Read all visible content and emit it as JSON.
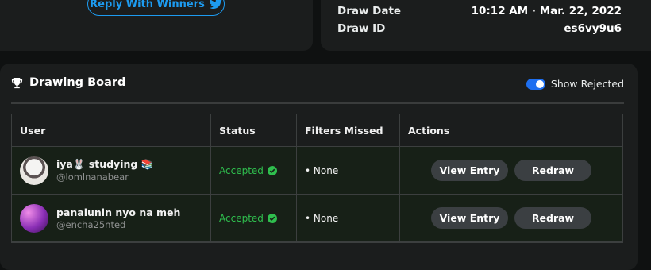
{
  "reply": {
    "label": "Reply With Winners"
  },
  "draw_info": {
    "date_label": "Draw Date",
    "date_value": "10:12 AM · Mar. 22, 2022",
    "id_label": "Draw ID",
    "id_value": "es6vy9u6"
  },
  "board": {
    "title": "Drawing Board",
    "toggle_label": "Show Rejected",
    "toggle_on": true
  },
  "table": {
    "headers": [
      "User",
      "Status",
      "Filters Missed",
      "Actions"
    ],
    "rows": [
      {
        "name": "iya🐰 studying 📚",
        "handle": "@lomlnanabear",
        "status": "Accepted",
        "filters": "• None",
        "view_label": "View Entry",
        "redraw_label": "Redraw"
      },
      {
        "name": "panalunin nyo na meh",
        "handle": "@encha25nted",
        "status": "Accepted",
        "filters": "• None",
        "view_label": "View Entry",
        "redraw_label": "Redraw"
      }
    ]
  },
  "colors": {
    "accent_blue": "#1d9bf0",
    "status_green": "#2fbf4e",
    "toggle_blue": "#1e6ff0"
  }
}
